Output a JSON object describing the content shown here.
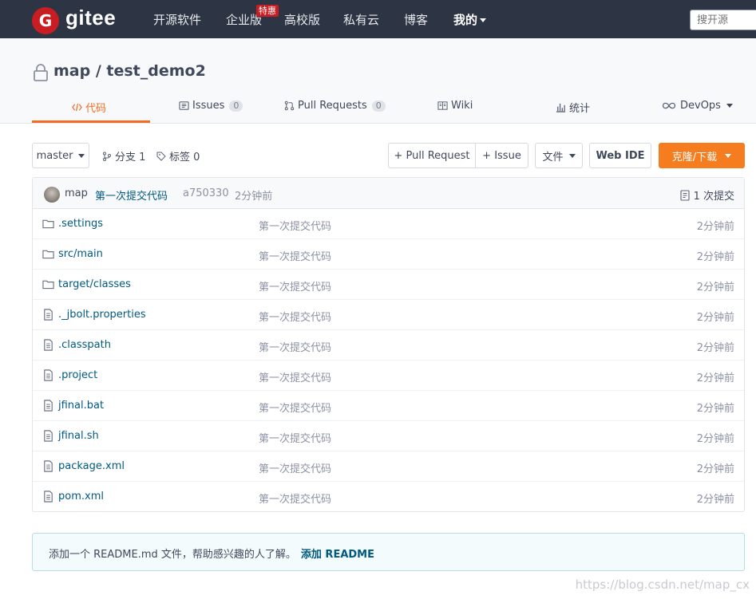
{
  "nav": {
    "logo_letter": "G",
    "logo_text": "gitee",
    "items": [
      "开源软件",
      "企业版",
      "高校版",
      "私有云",
      "博客",
      "我的"
    ],
    "badge": "特惠",
    "search_placeholder": "搜开源"
  },
  "repo": {
    "owner": "map",
    "name": "test_demo2",
    "title": "map / test_demo2"
  },
  "tabs": [
    {
      "label": "代码",
      "count": null
    },
    {
      "label": "Issues",
      "count": "0"
    },
    {
      "label": "Pull Requests",
      "count": "0"
    },
    {
      "label": "Wiki",
      "count": null
    },
    {
      "label": "统计",
      "count": null
    },
    {
      "label": "DevOps",
      "count": null
    }
  ],
  "toolbar": {
    "branch": "master",
    "branches_label": "分支 1",
    "tags_label": "标签 0",
    "pull_request": "+ Pull Request",
    "issue": "+ Issue",
    "file": "文件",
    "web_ide": "Web IDE",
    "clone": "克隆/下载"
  },
  "last_commit": {
    "author": "map",
    "message": "第一次提交代码",
    "hash": "a750330",
    "time": "2分钟前",
    "commits": "1 次提交"
  },
  "files": [
    {
      "name": ".settings",
      "type": "folder",
      "message": "第一次提交代码",
      "time": "2分钟前"
    },
    {
      "name": "src/main",
      "type": "folder",
      "message": "第一次提交代码",
      "time": "2分钟前"
    },
    {
      "name": "target/classes",
      "type": "folder",
      "message": "第一次提交代码",
      "time": "2分钟前"
    },
    {
      "name": "._jbolt.properties",
      "type": "file",
      "message": "第一次提交代码",
      "time": "2分钟前"
    },
    {
      "name": ".classpath",
      "type": "file",
      "message": "第一次提交代码",
      "time": "2分钟前"
    },
    {
      "name": ".project",
      "type": "file",
      "message": "第一次提交代码",
      "time": "2分钟前"
    },
    {
      "name": "jfinal.bat",
      "type": "file",
      "message": "第一次提交代码",
      "time": "2分钟前"
    },
    {
      "name": "jfinal.sh",
      "type": "file",
      "message": "第一次提交代码",
      "time": "2分钟前"
    },
    {
      "name": "package.xml",
      "type": "file",
      "message": "第一次提交代码",
      "time": "2分钟前"
    },
    {
      "name": "pom.xml",
      "type": "file",
      "message": "第一次提交代码",
      "time": "2分钟前"
    }
  ],
  "readme": {
    "text": "添加一个 README.md 文件，帮助感兴趣的人了解。",
    "link": "添加 README"
  },
  "watermark": "https://blog.csdn.net/map_cx",
  "colors": {
    "nav_bg": "#2d3544",
    "accent": "#f36c21",
    "clone_bg": "#f57c1f",
    "link": "#005980"
  }
}
